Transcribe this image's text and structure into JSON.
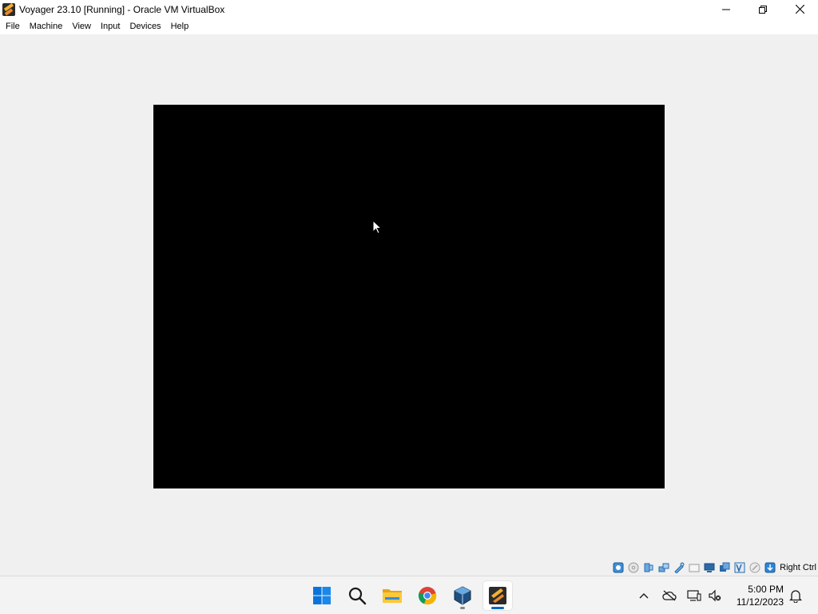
{
  "window": {
    "title": "Voyager 23.10 [Running] - Oracle VM VirtualBox",
    "controls": {
      "minimize": "minimize-icon",
      "restore": "restore-icon",
      "close": "close-icon"
    }
  },
  "menubar": {
    "items": [
      "File",
      "Machine",
      "View",
      "Input",
      "Devices",
      "Help"
    ]
  },
  "vm_display": {
    "background": "#000000"
  },
  "statusbar": {
    "icons": [
      "hard-disk-icon",
      "optical-drive-icon",
      "audio-icon",
      "network-icon",
      "usb-icon",
      "shared-folders-icon",
      "display-icon",
      "recording-icon",
      "cpu-icon",
      "mouse-integration-icon",
      "keyboard-icon"
    ],
    "host_key": "Right Ctrl"
  },
  "taskbar": {
    "apps": [
      "start-icon",
      "search-icon",
      "file-explorer-icon",
      "chrome-icon",
      "virtualbox-icon",
      "vm-window-icon"
    ],
    "tray": {
      "icons": [
        "show-hidden-icons-chevron",
        "onedrive-icon",
        "network-icon",
        "volume-muted-icon"
      ],
      "time": "5:00 PM",
      "date": "11/12/2023",
      "notification_icon": "bell-icon"
    }
  },
  "colors": {
    "window_bg": "#f0f0f0",
    "accent": "#0067c0"
  }
}
